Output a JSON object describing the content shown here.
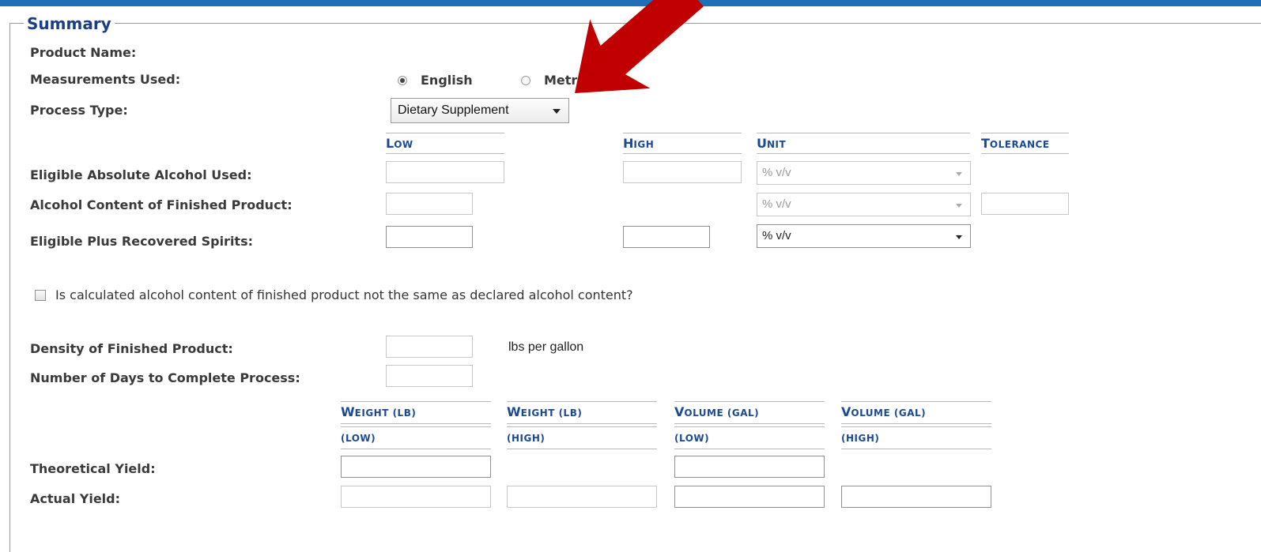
{
  "legend": "Summary",
  "labels": {
    "product_name": "Product Name:",
    "measurements": "Measurements Used:",
    "process_type": "Process Type:",
    "eligible_absolute": "Eligible Absolute Alcohol Used:",
    "alcohol_content": "Alcohol Content of Finished Product:",
    "eligible_plus": "Eligible Plus Recovered Spirits:",
    "density": "Density of Finished Product:",
    "days": "Number of Days to Complete Process:",
    "theoretical": "Theoretical Yield:",
    "actual": "Actual Yield:"
  },
  "measurements": {
    "english": "English",
    "metric": "Metri",
    "selected": "English"
  },
  "process_type": {
    "value": "Dietary Supplement"
  },
  "columns1": {
    "low": [
      "L",
      "OW"
    ],
    "high": [
      "H",
      "IGH"
    ],
    "unit": [
      "U",
      "NIT"
    ],
    "tolerance": [
      "T",
      "OLERANCE"
    ]
  },
  "units": {
    "eligible_absolute": "% v/v",
    "alcohol_content": "% v/v",
    "eligible_plus": "% v/v"
  },
  "checkbox_question": "Is calculated alcohol content of finished product not the same as declared alcohol content?",
  "density_unit": "lbs per gallon",
  "columns2": {
    "weight_low": {
      "top": [
        "W",
        "EIGHT (LB)"
      ],
      "bottom": "(LOW)"
    },
    "weight_high": {
      "top": [
        "W",
        "EIGHT (LB)"
      ],
      "bottom": "(HIGH)"
    },
    "volume_low": {
      "top": [
        "V",
        "OLUME (GAL)"
      ],
      "bottom": "(LOW)"
    },
    "volume_high": {
      "top": [
        "V",
        "OLUME (GAL)"
      ],
      "bottom": "(HIGH)"
    }
  },
  "colors": {
    "accent": "#1f6fb6",
    "heading": "#1a4a96",
    "arrow": "#c00000"
  }
}
